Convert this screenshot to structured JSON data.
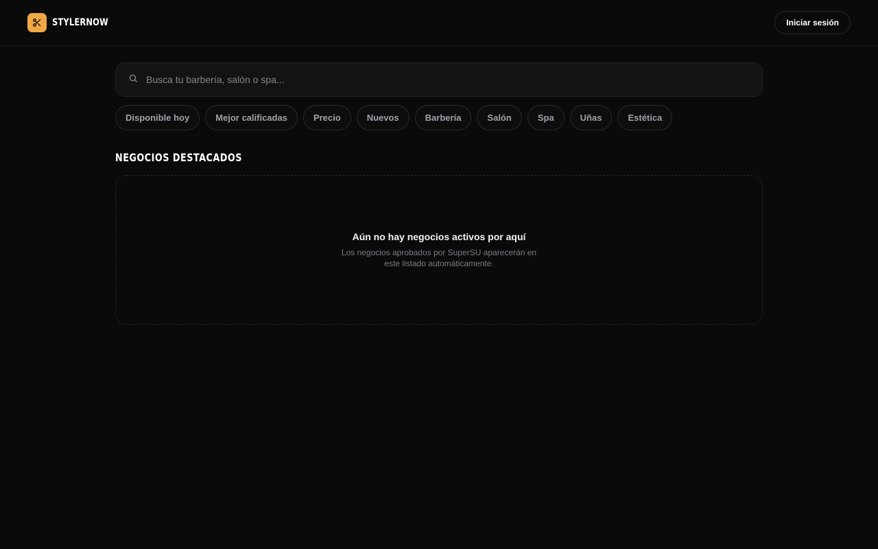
{
  "header": {
    "brand_name": "STYLERNOW",
    "logo_icon": "scissors-icon",
    "login_label": "Iniciar sesión"
  },
  "search": {
    "icon": "search-icon",
    "placeholder": "Busca tu barbería, salón o spa...",
    "value": ""
  },
  "filters": [
    "Disponible hoy",
    "Mejor calificadas",
    "Precio",
    "Nuevos",
    "Barbería",
    "Salón",
    "Spa",
    "Uñas",
    "Estética"
  ],
  "featured": {
    "title": "NEGOCIOS DESTACADOS",
    "empty_title": "Aún no hay negocios activos por aquí",
    "empty_description": "Los negocios aprobados por SuperSU aparecerán en este listado automáticamente."
  },
  "colors": {
    "background": "#0a0a0a",
    "accent": "#f0a845",
    "border": "#2a2a2a"
  }
}
